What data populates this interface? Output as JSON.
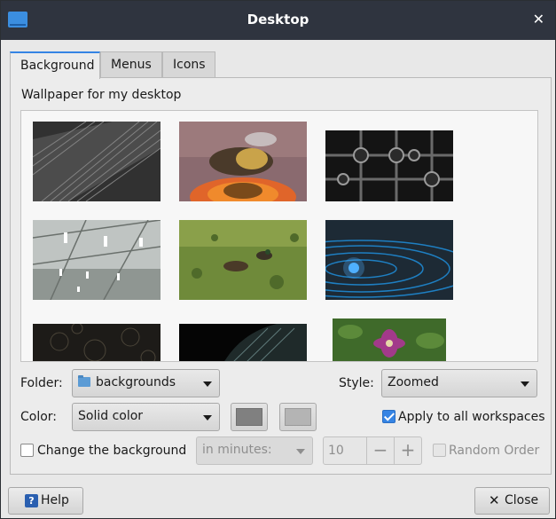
{
  "window": {
    "title": "Desktop"
  },
  "tabs": [
    {
      "label": "Background"
    },
    {
      "label": "Menus"
    },
    {
      "label": "Icons"
    }
  ],
  "background": {
    "heading": "Wallpaper for my desktop",
    "wallpapers": [
      {
        "subject": "abstract grey architecture"
      },
      {
        "subject": "bee on orange flower"
      },
      {
        "subject": "industrial pipes and valves"
      },
      {
        "subject": "ceiling lights"
      },
      {
        "subject": "ducks on green pond"
      },
      {
        "subject": "blue light rings"
      },
      {
        "subject": "dark floral pattern"
      },
      {
        "subject": "dark leaf texture"
      },
      {
        "subject": "pink clematis flower"
      }
    ],
    "folder_label": "Folder:",
    "folder_value": "backgrounds",
    "style_label": "Style:",
    "style_value": "Zoomed",
    "color_label": "Color:",
    "color_value": "Solid color",
    "primary_color": "#808080",
    "secondary_color": "#b4b4b4",
    "apply_all_label": "Apply to all workspaces",
    "apply_all_checked": true,
    "change_bg_label": "Change the background",
    "change_bg_checked": false,
    "interval_unit": "in minutes:",
    "interval_value": "10",
    "random_order_label": "Random Order",
    "random_order_checked": false
  },
  "footer": {
    "help_label": "Help",
    "close_label": "Close"
  }
}
